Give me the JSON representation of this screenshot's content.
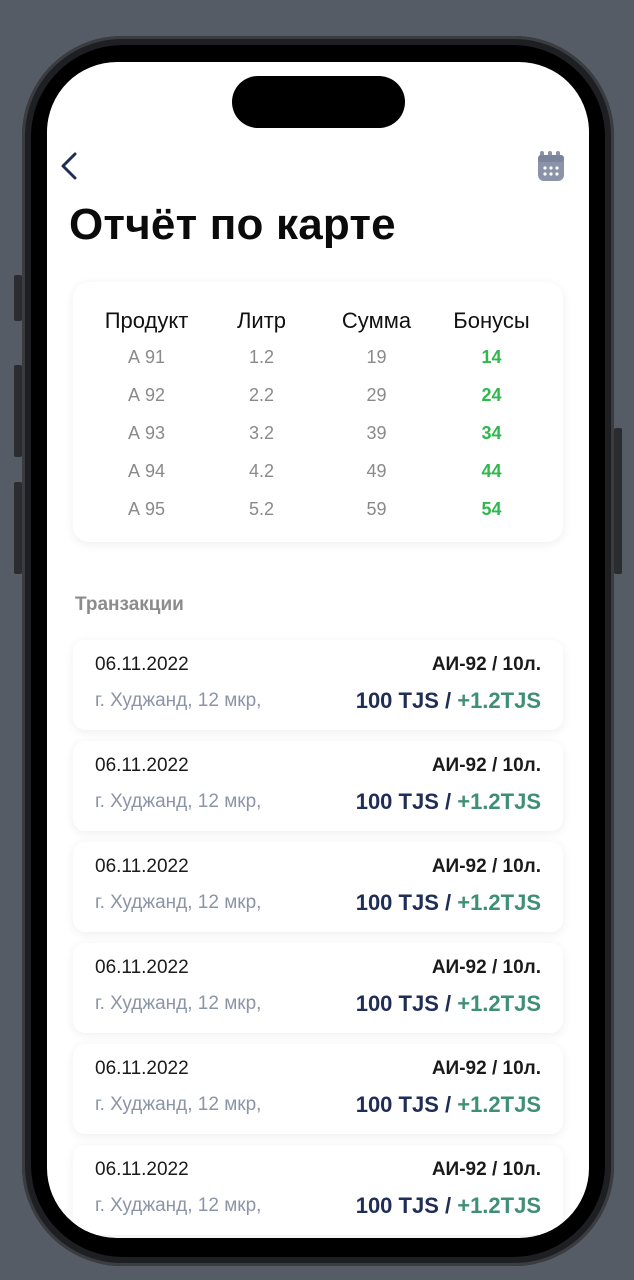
{
  "header": {
    "back_icon": "chevron-left-icon",
    "calendar_icon": "calendar-icon",
    "title": "Отчёт по карте"
  },
  "colors": {
    "bonus_green": "#2fb84c",
    "amount_navy": "#1f2d57",
    "tx_bonus_green": "#3f8f74",
    "calendar_icon": "#8a93a8"
  },
  "report": {
    "columns": [
      "Продукт",
      "Литр",
      "Сумма",
      "Бонусы"
    ],
    "rows": [
      {
        "product": "А 91",
        "liters": "1.2",
        "sum": "19",
        "bonus": "14"
      },
      {
        "product": "А 92",
        "liters": "2.2",
        "sum": "29",
        "bonus": "24"
      },
      {
        "product": "А 93",
        "liters": "3.2",
        "sum": "39",
        "bonus": "34"
      },
      {
        "product": "А 94",
        "liters": "4.2",
        "sum": "49",
        "bonus": "44"
      },
      {
        "product": "А 95",
        "liters": "5.2",
        "sum": "59",
        "bonus": "54"
      }
    ]
  },
  "transactions": {
    "title": "Транзакции",
    "items": [
      {
        "date": "06.11.2022",
        "fuel": "АИ-92 / 10л.",
        "location": "г. Худжанд, 12 мкр,",
        "amount": "100 TJS / ",
        "bonus": "+1.2TJS"
      },
      {
        "date": "06.11.2022",
        "fuel": "АИ-92 / 10л.",
        "location": "г. Худжанд, 12 мкр,",
        "amount": "100 TJS / ",
        "bonus": "+1.2TJS"
      },
      {
        "date": "06.11.2022",
        "fuel": "АИ-92 / 10л.",
        "location": "г. Худжанд, 12 мкр,",
        "amount": "100 TJS / ",
        "bonus": "+1.2TJS"
      },
      {
        "date": "06.11.2022",
        "fuel": "АИ-92 / 10л.",
        "location": "г. Худжанд, 12 мкр,",
        "amount": "100 TJS / ",
        "bonus": "+1.2TJS"
      },
      {
        "date": "06.11.2022",
        "fuel": "АИ-92 / 10л.",
        "location": "г. Худжанд, 12 мкр,",
        "amount": "100 TJS / ",
        "bonus": "+1.2TJS"
      },
      {
        "date": "06.11.2022",
        "fuel": "АИ-92 / 10л.",
        "location": "г. Худжанд, 12 мкр,",
        "amount": "100 TJS / ",
        "bonus": "+1.2TJS"
      }
    ]
  }
}
